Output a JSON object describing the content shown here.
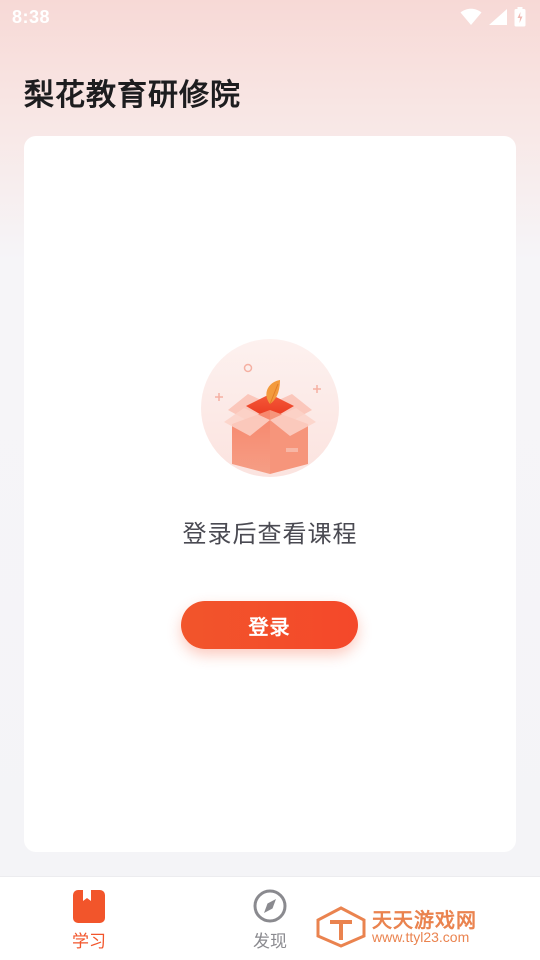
{
  "status_bar": {
    "time": "8:38",
    "icons": [
      "wifi-icon",
      "signal-icon",
      "battery-icon"
    ]
  },
  "header": {
    "title": "梨花教育研修院"
  },
  "main": {
    "illustration_icon": "empty-box-icon",
    "message": "登录后查看课程",
    "login_button_label": "登录"
  },
  "bottom_nav": {
    "items": [
      {
        "label": "学习",
        "icon": "bookmark-book-icon",
        "active": true
      },
      {
        "label": "发现",
        "icon": "compass-icon",
        "active": false
      }
    ]
  },
  "watermark": {
    "text": "天天游戏网",
    "url": "www.ttyl23.com"
  },
  "colors": {
    "accent": "#f2552b",
    "inactive": "#8a8a8f",
    "title": "#1d1d1f"
  }
}
